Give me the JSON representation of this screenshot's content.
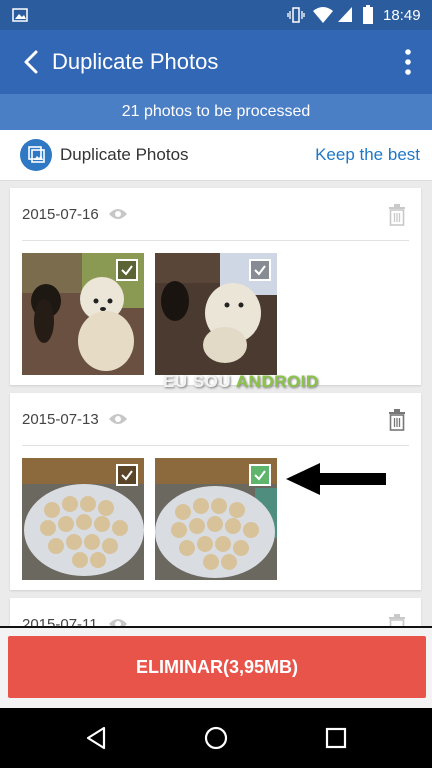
{
  "status": {
    "time": "18:49",
    "icons": [
      "image-icon",
      "vibrate-icon",
      "wifi-icon",
      "cell-signal-icon",
      "battery-icon"
    ]
  },
  "appbar": {
    "title": "Duplicate Photos",
    "back_icon": "arrow-back-icon",
    "more_icon": "more-vertical-icon"
  },
  "banner": {
    "text": "21 photos to be processed"
  },
  "subheader": {
    "label": "Duplicate Photos",
    "keep_link": "Keep the best"
  },
  "groups": [
    {
      "date": "2015-07-16",
      "photos": [
        {
          "subject": "white poodle and black chihuahua",
          "checked": true,
          "selected": false
        },
        {
          "subject": "white poodle on sofa",
          "checked": true,
          "selected": false
        }
      ]
    },
    {
      "date": "2015-07-13",
      "photos": [
        {
          "subject": "plate of cheese breads",
          "checked": true,
          "selected": false
        },
        {
          "subject": "plate of cheese breads",
          "checked": true,
          "selected": true
        }
      ]
    },
    {
      "date": "2015-07-11"
    }
  ],
  "watermark": {
    "part1": "EU SOU ",
    "part2": "ANDROID"
  },
  "action": {
    "delete_label": "ELIMINAR(3,95MB)"
  },
  "colors": {
    "primary": "#3167b4",
    "banner": "#4b7fc5",
    "link": "#1f78c8",
    "delete": "#e8534a",
    "check_selected": "#5fb56b"
  }
}
